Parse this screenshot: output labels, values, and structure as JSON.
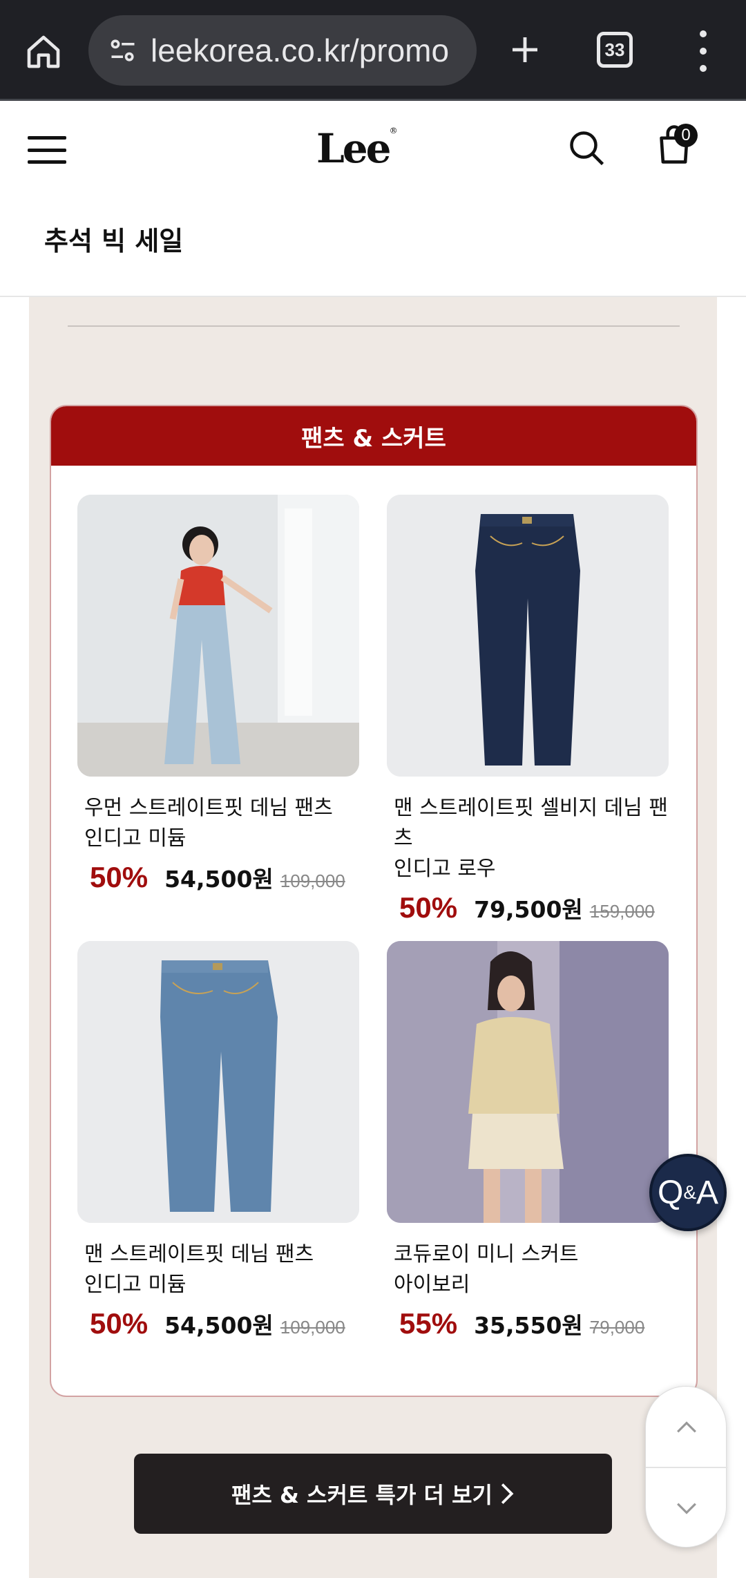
{
  "browser": {
    "url": "leekorea.co.kr/promo",
    "tab_count": "33"
  },
  "header": {
    "logo_text": "Lee",
    "logo_mark": "®",
    "cart_count": "0"
  },
  "page": {
    "title": "추석 빅 세일"
  },
  "category": {
    "title": "팬츠 & 스커트",
    "products": [
      {
        "name_line1": "우먼 스트레이트핏 데님 팬츠",
        "name_line2": "인디고 미듐",
        "discount": "50%",
        "sale_price": "54,500원",
        "original_price": "109,000",
        "image": "model-light-denim-red-top"
      },
      {
        "name_line1": "맨 스트레이트핏 셀비지 데님 팬츠",
        "name_line2": "인디고 로우",
        "discount": "50%",
        "sale_price": "79,500원",
        "original_price": "159,000",
        "image": "dark-denim-jeans-flat"
      },
      {
        "name_line1": "맨 스트레이트핏 데님 팬츠",
        "name_line2": "인디고 미듐",
        "discount": "50%",
        "sale_price": "54,500원",
        "original_price": "109,000",
        "image": "medium-denim-jeans-flat"
      },
      {
        "name_line1": "코듀로이 미니 스커트",
        "name_line2": "아이보리",
        "discount": "55%",
        "sale_price": "35,550원",
        "original_price": "79,000",
        "image": "model-ivory-mini-skirt"
      }
    ]
  },
  "more_button": {
    "label": "팬츠 & 스커트 특가 더 보기"
  },
  "floating": {
    "qa_main": "Q",
    "qa_amp": "&",
    "qa_end": "A"
  },
  "colors": {
    "accent_red": "#a00d0d",
    "promo_bg": "#efe9e4",
    "button_dark": "#231f20",
    "qa_navy": "#1b2a4a"
  },
  "icons": [
    "home-icon",
    "site-settings-icon",
    "plus-icon",
    "tab-switcher-icon",
    "more-vert-icon",
    "menu-icon",
    "search-icon",
    "cart-icon",
    "chevron-right-icon",
    "chevron-up-icon",
    "chevron-down-icon"
  ]
}
